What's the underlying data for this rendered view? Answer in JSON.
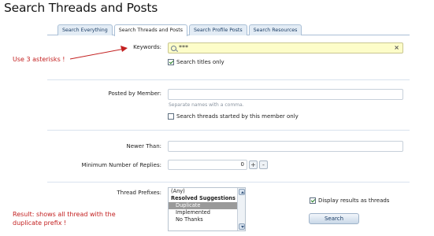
{
  "page": {
    "title": "Search Threads and Posts"
  },
  "tabs": [
    {
      "label": "Search Everything",
      "active": false
    },
    {
      "label": "Search Threads and Posts",
      "active": true
    },
    {
      "label": "Search Profile Posts",
      "active": false
    },
    {
      "label": "Search Resources",
      "active": false
    }
  ],
  "keywords": {
    "label": "Keywords:",
    "value": "***",
    "search_titles_only_label": "Search titles only",
    "search_titles_only_checked": true,
    "search_icon": "search-icon",
    "clear_symbol": "×"
  },
  "posted_by": {
    "label": "Posted by Member:",
    "value": "",
    "hint": "Separate names with a comma.",
    "started_only_label": "Search threads started by this member only",
    "started_only_checked": false
  },
  "newer_than": {
    "label": "Newer Than:",
    "value": ""
  },
  "min_replies": {
    "label": "Minimum Number of Replies:",
    "value": "0",
    "plus": "+",
    "minus": "-"
  },
  "prefixes": {
    "label": "Thread Prefixes:",
    "options": [
      {
        "text": "(Any)",
        "group": false,
        "indent": false,
        "selected": false
      },
      {
        "text": "Resolved Suggestions",
        "group": true,
        "indent": false,
        "selected": false
      },
      {
        "text": "Duplicate",
        "group": false,
        "indent": true,
        "selected": true
      },
      {
        "text": "Implemented",
        "group": false,
        "indent": true,
        "selected": false
      },
      {
        "text": "No Thanks",
        "group": false,
        "indent": true,
        "selected": false
      }
    ]
  },
  "display_as_threads": {
    "label": "Display results as threads",
    "checked": true
  },
  "search_button": {
    "label": "Search"
  },
  "annotations": {
    "asterisks": "Use 3 asterisks !",
    "result": "Result: shows all thread with the duplicate prefix !",
    "color": "#c32020"
  }
}
